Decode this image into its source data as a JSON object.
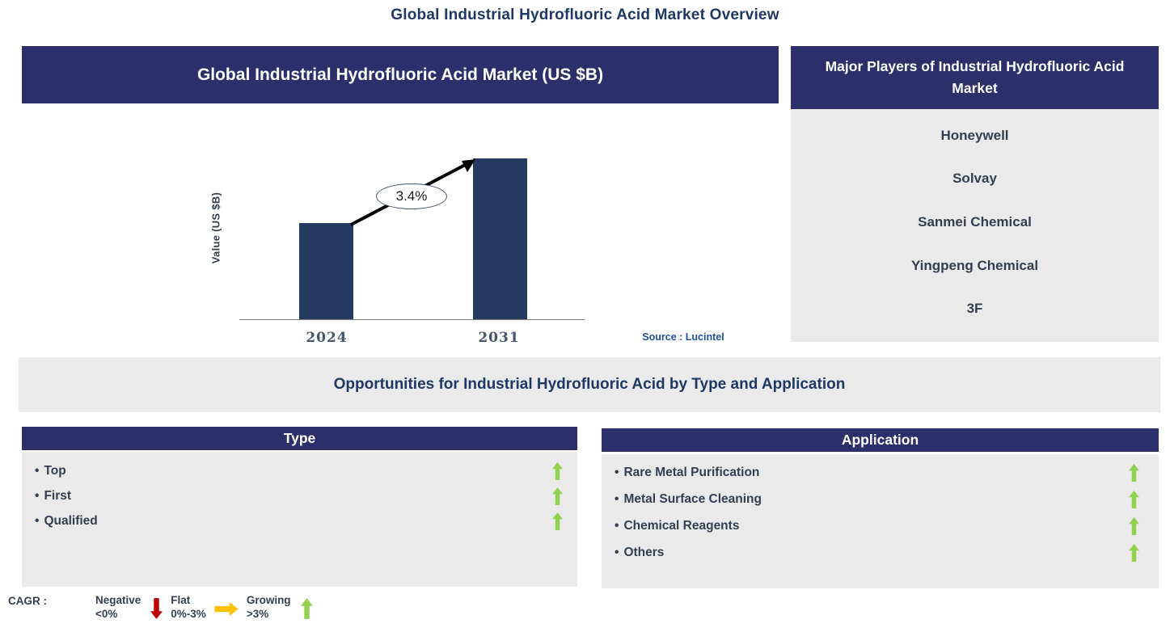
{
  "page_title": "Global Industrial Hydrofluoric Acid Market Overview",
  "market_chart_panel": {
    "header": "Global Industrial Hydrofluoric Acid Market (US $B)",
    "source": "Source : Lucintel"
  },
  "chart_data": {
    "type": "bar",
    "title": "Global Industrial Hydrofluoric Acid Market (US $B)",
    "ylabel": "Value (US $B)",
    "xlabel": "",
    "categories": [
      "2024",
      "2031"
    ],
    "values_relative": [
      0.6,
      1.0
    ],
    "value_axis_ticks_shown": false,
    "cagr_label": "3.4%",
    "annotation": "Arrow from top of 2024 bar to top of 2031 bar through ellipse labeled 3.4%",
    "bar_color": "#243A5E",
    "legend_position": "none",
    "grid": false
  },
  "players_panel": {
    "header": "Major Players of Industrial Hydrofluoric Acid Market",
    "players": [
      "Honeywell",
      "Solvay",
      "Sanmei Chemical",
      "Yingpeng Chemical",
      "3F"
    ]
  },
  "opportunities_banner": "Opportunities for Industrial Hydrofluoric Acid by Type and Application",
  "type_panel": {
    "header": "Type",
    "bullet": "•",
    "items": [
      {
        "label": "Top",
        "trend": "growing"
      },
      {
        "label": "First",
        "trend": "growing"
      },
      {
        "label": "Qualified",
        "trend": "growing"
      }
    ]
  },
  "application_panel": {
    "header": "Application",
    "bullet": "•",
    "items": [
      {
        "label": "Rare Metal Purification",
        "trend": "growing"
      },
      {
        "label": "Metal Surface Cleaning",
        "trend": "growing"
      },
      {
        "label": "Chemical Reagents",
        "trend": "growing"
      },
      {
        "label": "Others",
        "trend": "growing"
      }
    ]
  },
  "cagr_legend": {
    "label": "CAGR :",
    "entries": [
      {
        "name": "Negative",
        "range": "<0%",
        "icon": "red-down-arrow",
        "color": "#C00000"
      },
      {
        "name": "Flat",
        "range": "0%-3%",
        "icon": "yellow-right-arrow",
        "color": "#FFC000"
      },
      {
        "name": "Growing",
        "range": ">3%",
        "icon": "green-up-arrow",
        "color": "#92D050"
      }
    ]
  },
  "colors": {
    "header_navy": "#2C306A",
    "bar_navy": "#243A5E",
    "panel_gray": "#EAEAEA",
    "title_navy": "#1F3864",
    "body_text": "#333F50",
    "axis_label": "#44546A",
    "source_blue": "#1F4E9B",
    "growing_green": "#92D050",
    "negative_red": "#C00000",
    "flat_yellow": "#FFC000"
  }
}
